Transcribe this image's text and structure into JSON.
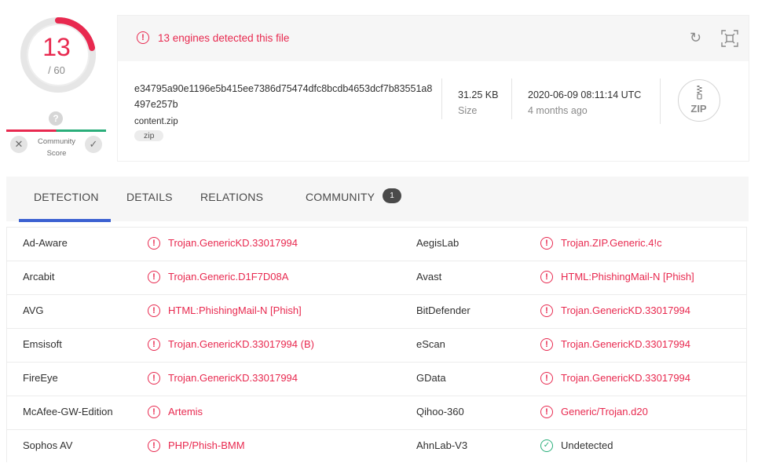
{
  "score": {
    "detected": "13",
    "total": "/ 60",
    "detected_fraction": 0.2167
  },
  "community": {
    "question_mark": "?",
    "label_line1": "Community",
    "label_line2": "Score",
    "downvote_glyph": "✕",
    "upvote_glyph": "✓"
  },
  "alert": {
    "text": "13 engines detected this file",
    "icon": "alert-circle-icon"
  },
  "header_icons": {
    "reanalyze": "↻",
    "similar": "⌗"
  },
  "file": {
    "hash": "e34795a90e1196e5b415ee7386d75474dfc8bcdb4653dcf7b83551a8497e257b",
    "name": "content.zip",
    "tag": "zip",
    "size_value": "31.25 KB",
    "size_label": "Size",
    "date_value": "2020-06-09 08:11:14 UTC",
    "date_relative": "4 months ago",
    "type_badge": "ZIP"
  },
  "tabs": {
    "detection": "DETECTION",
    "details": "DETAILS",
    "relations": "RELATIONS",
    "community": "COMMUNITY",
    "community_count": "1"
  },
  "colors": {
    "malicious": "#e8294f",
    "clean": "#2aae7a",
    "accent": "#3b61d1"
  },
  "detections": [
    {
      "left_engine": "Ad-Aware",
      "left_result": "Trojan.GenericKD.33017994",
      "right_engine": "AegisLab",
      "right_result": "Trojan.ZIP.Generic.4!c"
    },
    {
      "left_engine": "Arcabit",
      "left_result": "Trojan.Generic.D1F7D08A",
      "right_engine": "Avast",
      "right_result": "HTML:PhishingMail-N [Phish]"
    },
    {
      "left_engine": "AVG",
      "left_result": "HTML:PhishingMail-N [Phish]",
      "right_engine": "BitDefender",
      "right_result": "Trojan.GenericKD.33017994"
    },
    {
      "left_engine": "Emsisoft",
      "left_result": "Trojan.GenericKD.33017994 (B)",
      "right_engine": "eScan",
      "right_result": "Trojan.GenericKD.33017994"
    },
    {
      "left_engine": "FireEye",
      "left_result": "Trojan.GenericKD.33017994",
      "right_engine": "GData",
      "right_result": "Trojan.GenericKD.33017994"
    },
    {
      "left_engine": "McAfee-GW-Edition",
      "left_result": "Artemis",
      "right_engine": "Qihoo-360",
      "right_result": "Generic/Trojan.d20"
    },
    {
      "left_engine": "Sophos AV",
      "left_result": "PHP/Phish-BMM",
      "right_engine": "AhnLab-V3",
      "right_result": "Undetected"
    }
  ]
}
